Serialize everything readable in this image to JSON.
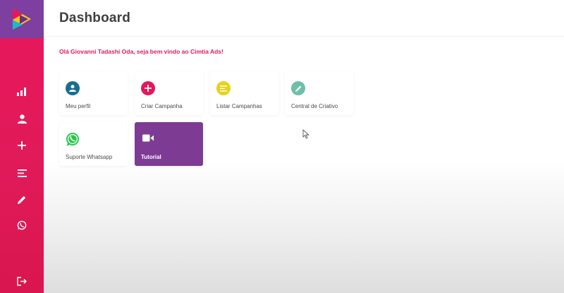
{
  "app": {
    "page_title": "Dashboard",
    "welcome_text": "Olá Giovanni Tadashi Oda, seja bem vindo ao Cimtia Ads!"
  },
  "colors": {
    "sidebar": "#e8175d",
    "logo_bg": "#7d3fa0",
    "accent": "#e2185b",
    "tutorial_card": "#7e3b94"
  },
  "sidebar": {
    "items": [
      {
        "icon": "bar-chart-icon"
      },
      {
        "icon": "user-icon"
      },
      {
        "icon": "plus-icon"
      },
      {
        "icon": "list-icon"
      },
      {
        "icon": "pencil-icon"
      },
      {
        "icon": "whatsapp-icon"
      },
      {
        "icon": "logout-icon"
      }
    ]
  },
  "cards": [
    {
      "label": "Meu perfil",
      "icon": "user-icon",
      "icon_color": "#1a6e8c"
    },
    {
      "label": "Criar Campanha",
      "icon": "plus-icon",
      "icon_color": "#e2185b"
    },
    {
      "label": "Listar Campanhas",
      "icon": "list-icon",
      "icon_color": "#e6d21c"
    },
    {
      "label": "Central de Criativo",
      "icon": "pencil-icon",
      "icon_color": "#6cc0a8"
    },
    {
      "label": "Suporte Whatsapp",
      "icon": "whatsapp-icon",
      "icon_color": "#2ac54f"
    },
    {
      "label": "Tutorial",
      "icon": "video-camera-icon",
      "icon_color": "#ffffff"
    }
  ]
}
